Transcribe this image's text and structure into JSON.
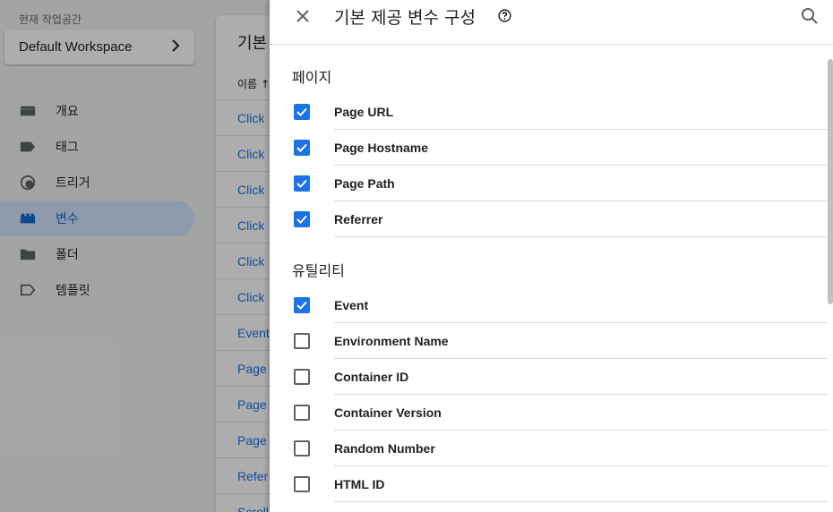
{
  "sidebar": {
    "workspace_label": "현재 작업공간",
    "workspace_name": "Default Workspace",
    "items": [
      {
        "label": "개요",
        "icon": "overview-icon"
      },
      {
        "label": "태그",
        "icon": "tag-icon"
      },
      {
        "label": "트리거",
        "icon": "trigger-icon"
      },
      {
        "label": "변수",
        "icon": "variables-icon",
        "active": true
      },
      {
        "label": "폴더",
        "icon": "folder-icon"
      },
      {
        "label": "템플릿",
        "icon": "template-icon"
      }
    ]
  },
  "background_card": {
    "title": "기본",
    "column_header": "이름",
    "rows": [
      "Click",
      "Click",
      "Click",
      "Click",
      "Click",
      "Click",
      "Event",
      "Page",
      "Page",
      "Page",
      "Refer",
      "Scroll"
    ]
  },
  "dialog": {
    "title": "기본 제공 변수 구성",
    "sections": [
      {
        "title": "페이지",
        "items": [
          {
            "label": "Page URL",
            "checked": true
          },
          {
            "label": "Page Hostname",
            "checked": true
          },
          {
            "label": "Page Path",
            "checked": true
          },
          {
            "label": "Referrer",
            "checked": true
          }
        ]
      },
      {
        "title": "유틸리티",
        "items": [
          {
            "label": "Event",
            "checked": true
          },
          {
            "label": "Environment Name",
            "checked": false
          },
          {
            "label": "Container ID",
            "checked": false
          },
          {
            "label": "Container Version",
            "checked": false
          },
          {
            "label": "Random Number",
            "checked": false
          },
          {
            "label": "HTML ID",
            "checked": false
          }
        ]
      }
    ]
  },
  "colors": {
    "accent": "#1a73e8",
    "nav_active_bg": "#d2e3fc",
    "link": "#1a73e8",
    "text": "#202124"
  }
}
